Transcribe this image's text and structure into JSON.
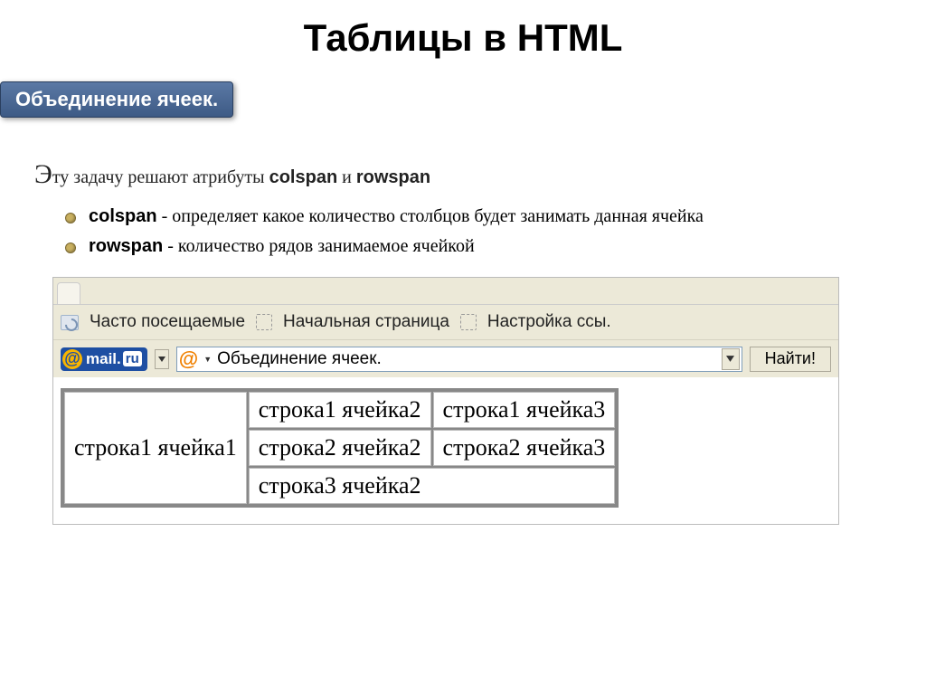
{
  "slide": {
    "title": "Таблицы в HTML",
    "section_badge": "Объединение ячеек."
  },
  "intro": {
    "prefix_letter": "Э",
    "line_part1": "ту задачу решают атрибуты ",
    "attr1": "colspan",
    "sep": " и ",
    "attr2": "rowspan"
  },
  "bullets": [
    {
      "term": "colspan",
      "desc": "  - определяет какое количество столбцов будет занимать данная ячейка"
    },
    {
      "term": "rowspan",
      "desc": "  - количество рядов занимаемое ячейкой"
    }
  ],
  "browser": {
    "bookmarks": {
      "frequent": "Часто посещаемые",
      "start_page": "Начальная страница",
      "custom_link": "Настройка ссы."
    },
    "logo": {
      "at": "@",
      "brand": "mail",
      "dot": ".",
      "tld": "ru"
    },
    "search_text": "Объединение ячеек.",
    "find_button": "Найти!"
  },
  "demo_table": {
    "r1c1": "строка1 ячейка1",
    "r1c2": "строка1 ячейка2",
    "r1c3": "строка1 ячейка3",
    "r2c2": "строка2 ячейка2",
    "r2c3": "строка2 ячейка3",
    "r3c2": "строка3 ячейка2"
  }
}
